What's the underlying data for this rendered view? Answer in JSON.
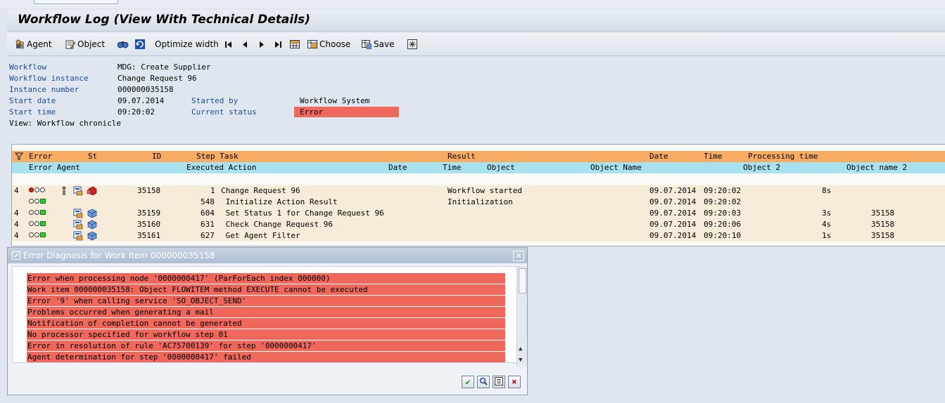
{
  "window": {
    "title": "Workflow Log (View With Technical Details)"
  },
  "toolbar": {
    "agent": "Agent",
    "object": "Object",
    "optimize": "Optimize width",
    "choose": "Choose",
    "save": "Save"
  },
  "header": {
    "workflow_label": "Workflow",
    "workflow_value": "MDG: Create Supplier",
    "instance_label": "Workflow instance",
    "instance_value": "Change Request 96",
    "number_label": "Instance number",
    "number_value": "000000035158",
    "start_date_label": "Start date",
    "start_date_value": "09.07.2014",
    "started_by_label": "Started by",
    "started_by_value": "Workflow System",
    "start_time_label": "Start time",
    "start_time_value": "09:20:02",
    "status_label": "Current status",
    "status_value": "Error",
    "view_line": "View: Workflow chronicle"
  },
  "table": {
    "h1": {
      "error": "Error",
      "st": "St",
      "id": "ID",
      "step_task": "Step Task",
      "result": "Result",
      "date": "Date",
      "time": "Time",
      "proc": "Processing time"
    },
    "h2": {
      "error_agent": "Error Agent",
      "exec_action": "Executed Action",
      "date": "Date",
      "time": "Time",
      "object": "Object",
      "object_name": "Object Name",
      "object2": "Object 2",
      "object_name2": "Object name 2"
    },
    "rows": [
      {
        "lvl": "4",
        "id": "35158",
        "step": "1",
        "task": "Change Request 96",
        "result": "Workflow started",
        "date": "09.07.2014",
        "time": "09:20:02",
        "proc": "8s",
        "obj2": ""
      },
      {
        "lvl": "",
        "id": "",
        "step": "548",
        "task": " Initialize Action Result",
        "result": "Initialization",
        "date": "09.07.2014",
        "time": "09:20:02",
        "proc": "",
        "obj2": ""
      },
      {
        "lvl": "4",
        "id": "35159",
        "step": "604",
        "task": " Set Status 1 for Change Request 96",
        "result": "",
        "date": "09.07.2014",
        "time": "09:20:03",
        "proc": "3s",
        "obj2": "35158"
      },
      {
        "lvl": "4",
        "id": "35160",
        "step": "631",
        "task": " Check Change Request 96",
        "result": "",
        "date": "09.07.2014",
        "time": "09:20:06",
        "proc": "4s",
        "obj2": "35158"
      },
      {
        "lvl": "4",
        "id": "35161",
        "step": "627",
        "task": " Get Agent Filter",
        "result": "",
        "date": "09.07.2014",
        "time": "09:20:10",
        "proc": "1s",
        "obj2": "35158"
      }
    ]
  },
  "dialog": {
    "title": "Error Diagnosis for Work Item 000000035158",
    "messages": [
      "Error when processing node '0000000417' (ParForEach index 000000)",
      "Work item 000000035158: Object FLOWITEM method EXECUTE cannot be executed",
      "Error '9' when calling service 'SO_OBJECT_SEND'",
      "Problems occurred when generating a mail",
      "Notification of completion cannot be generated",
      "No processor specified for workflow step 01",
      "Error in resolution of rule 'AC75700139' for step '0000000417'",
      "Agent determination for step '0000000417' failed"
    ]
  },
  "colors": {
    "error": "#f0675c",
    "header_orange": "#f8ab62",
    "header_cyan": "#a8e2f1"
  }
}
